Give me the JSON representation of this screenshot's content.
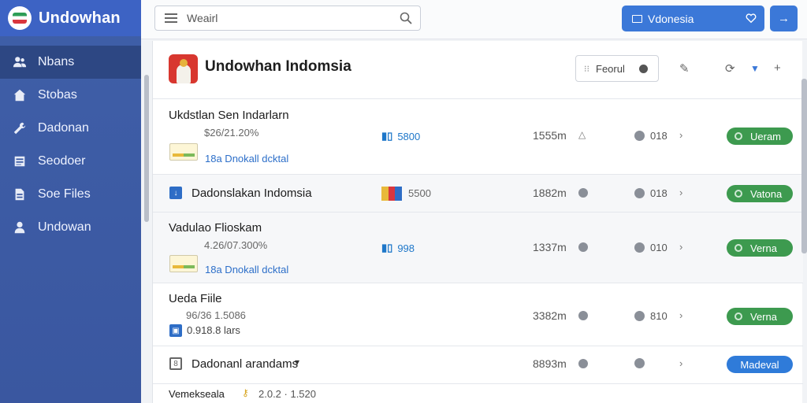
{
  "brand": {
    "name": "Undowhan"
  },
  "sidebar": {
    "items": [
      {
        "label": "Nbans",
        "icon": "users-icon",
        "active": true
      },
      {
        "label": "Stobas",
        "icon": "home-icon"
      },
      {
        "label": "Dadonan",
        "icon": "wrench-icon"
      },
      {
        "label": "Seodoer",
        "icon": "document-icon"
      },
      {
        "label": "Soe Files",
        "icon": "file-icon"
      },
      {
        "label": "Undowan",
        "icon": "person-icon"
      }
    ]
  },
  "topbar": {
    "search_value": "Weairl",
    "region_label": "Vdonesia",
    "arrow_label": "→"
  },
  "panel": {
    "title": "Undowhan Indomsia",
    "filter_label": "Feorul"
  },
  "rows": [
    {
      "title": "Ukdstlan Sen Indarlarn",
      "sub": "$26/21.20%",
      "link": "18a Dnokall dcktal",
      "stat": "5800",
      "size": "1555m",
      "count": "018",
      "action": "Ueram"
    },
    {
      "title": "Dadonslakan Indomsia",
      "stat": "5500",
      "size": "1882m",
      "count": "018",
      "action": "Vatona"
    },
    {
      "title": "Vadulao Flioskam",
      "sub": "4.26/07.300%",
      "link": "18a Dnokall dcktal",
      "stat": "998",
      "size": "1337m",
      "count": "010",
      "action": "Verna"
    },
    {
      "title": "Ueda Fiile",
      "sub": "96/36 1.5086",
      "link": "0.918.8 lars",
      "size": "3382m",
      "count": "810",
      "action": "Verna"
    },
    {
      "title": "Dadonanl arandams",
      "size": "8893m",
      "action": "Madeval"
    },
    {
      "title": "Vemekseala",
      "extra": "2.0.2  · 1.520"
    }
  ],
  "colors": {
    "sidebar": "#3f5fa8",
    "accent": "#3b78d8",
    "success": "#3d9a4f"
  }
}
